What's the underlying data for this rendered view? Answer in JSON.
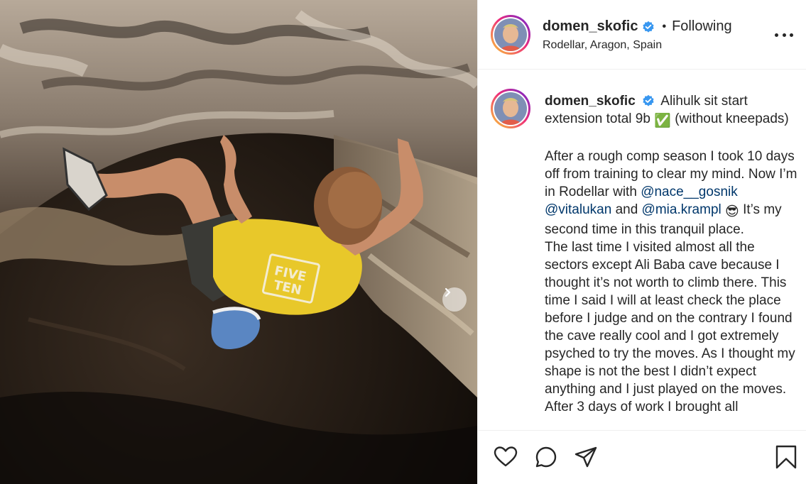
{
  "post": {
    "author": {
      "username": "domen_skofic",
      "verified": true,
      "follow_status": "Following",
      "separator": "•",
      "location": "Rodellar, Aragon, Spain"
    },
    "caption": {
      "username": "domen_skofic",
      "line1": "Alihulk sit start extension total 9b",
      "emoji_check": "✅",
      "line1_end": "(without kneepads)",
      "para2_a": "After a rough comp season I took 10 days off from training to clear my mind. Now I’m in Rodellar with",
      "mention1": "@nace__gosnik",
      "mention2": "@vitalukan",
      "and_text": "and",
      "mention3": "@mia.krampl",
      "emoji_cool": "😎",
      "para2_b": "It’s my second time in this tranquil place.",
      "para3": "The last time I visited almost all the sectors except Ali Baba cave because I thought it’s not worth to climb there. This time I said I will at least check the place before I judge and on the contrary I found the cave really cool and I got extremely psyched to try the moves. As I thought my shape is not the best I didn’t expect anything and I just played on the moves. After 3 days of work I brought all"
    },
    "media": {
      "alt": "Climber in yellow shirt on cave overhang",
      "shirt_text": "FIVE TEN"
    },
    "icons": {
      "verified": "verified-badge-icon",
      "more": "more-options-icon",
      "next": "chevron-right-icon",
      "like": "heart-icon",
      "comment": "comment-icon",
      "share": "paper-plane-icon",
      "save": "bookmark-icon"
    },
    "colors": {
      "verified_blue": "#3897f0",
      "mention_blue": "#00376b",
      "shirt_yellow": "#e8c82a"
    }
  }
}
